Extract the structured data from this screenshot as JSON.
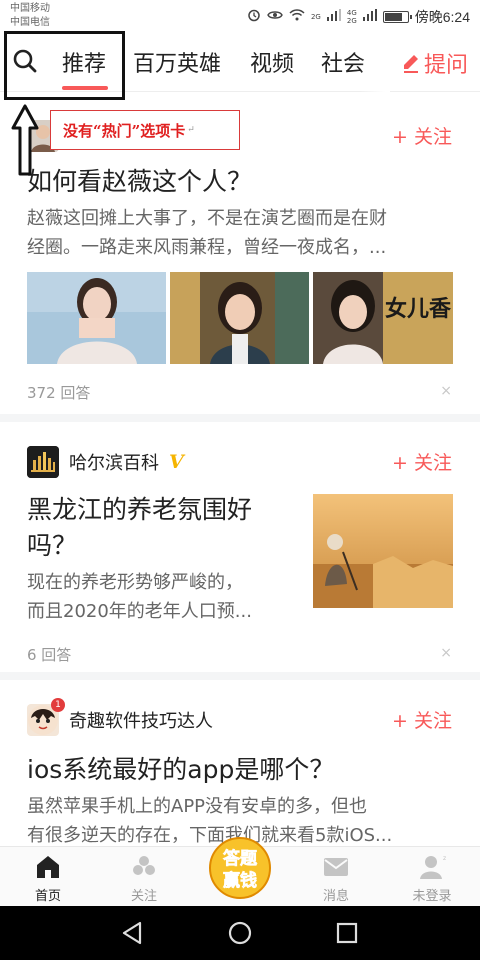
{
  "status_bar": {
    "carrier_1": "中国移动",
    "carrier_2": "中国电信",
    "net_1": "2G",
    "net_2": "4G",
    "net_3": "2G",
    "time": "傍晚6:24",
    "battery_level": 0.8
  },
  "tabs": {
    "items": [
      "推荐",
      "百万英雄",
      "视频",
      "社会"
    ],
    "active_index": 0,
    "ask_label": "提问"
  },
  "annotation": {
    "text": "没有“热门”选项卡",
    "mark": "↵"
  },
  "feed": [
    {
      "source": "",
      "follow_label": "+ 关注",
      "title": "如何看赵薇这个人？",
      "abstract_line_1": "赵薇这回摊上大事了，不是在演艺圈而是在财",
      "abstract_line_2": "经圈。一路走来风雨兼程，曾经一夜成名，...",
      "answers": "372 回答",
      "dismiss": "×",
      "thumbnail_2_caption": "女儿香"
    },
    {
      "source": "哈尔滨百科",
      "verified_badge": "V",
      "follow_label": "+ 关注",
      "title_line_1": "黑龙江的养老氛围好",
      "title_line_2": "吗？",
      "abstract_line_1": "现在的养老形势够严峻的，",
      "abstract_line_2": "而且2020年的老年人口预...",
      "answers": "6 回答",
      "dismiss": "×"
    },
    {
      "source": "奇趣软件技巧达人",
      "avatar_badge": "1",
      "follow_label": "+ 关注",
      "title": "ios系统最好的app是哪个？",
      "abstract_line_1": "虽然苹果手机上的APP没有安卓的多，但也",
      "abstract_line_2": "有很多逆天的存在，下面我们就来看5款iOS..."
    }
  ],
  "bottom_nav": {
    "home": "首页",
    "follow": "关注",
    "promo_line_1": "答题",
    "promo_line_2": "赢钱",
    "messages": "消息",
    "login": "未登录"
  },
  "colors": {
    "accent": "#f85959",
    "annotation_red": "#e02020",
    "verified_gold": "#f5b400"
  }
}
